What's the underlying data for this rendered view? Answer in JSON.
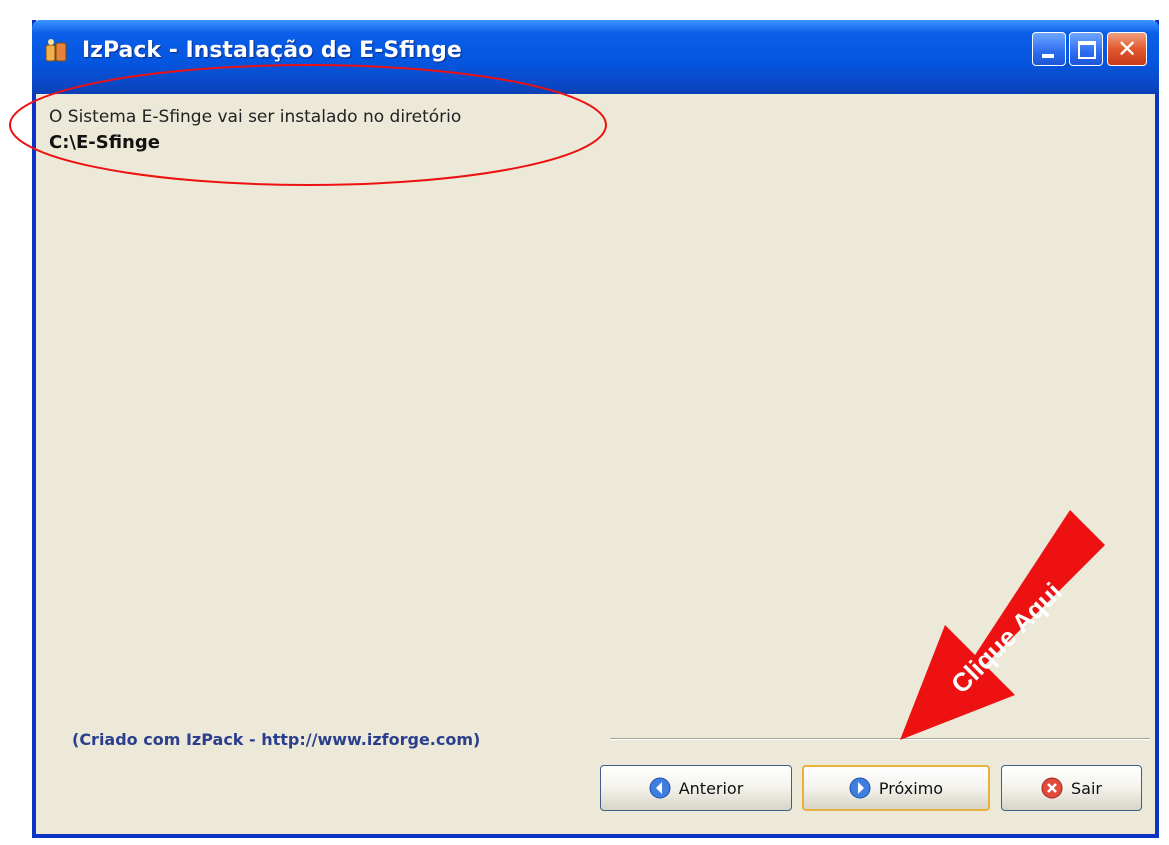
{
  "window": {
    "title": "IzPack - Instalação de E-Sfinge"
  },
  "content": {
    "line1": "O Sistema E-Sfinge vai ser instalado no diretório",
    "line2": "C:\\E-Sfinge"
  },
  "footer": {
    "credit": "(Criado com IzPack - http://www.izforge.com)"
  },
  "buttons": {
    "previous": "Anterior",
    "next": "Próximo",
    "exit": "Sair"
  },
  "annotation": {
    "label": "Clique Aqui"
  },
  "colors": {
    "title_bar": "#0556e0",
    "window_bg": "#ece9d8",
    "annotation_red": "#ee1111"
  },
  "icons": {
    "app": "izpack-app-icon",
    "previous": "back-arrow-icon",
    "next": "forward-arrow-icon",
    "exit": "red-x-icon"
  }
}
